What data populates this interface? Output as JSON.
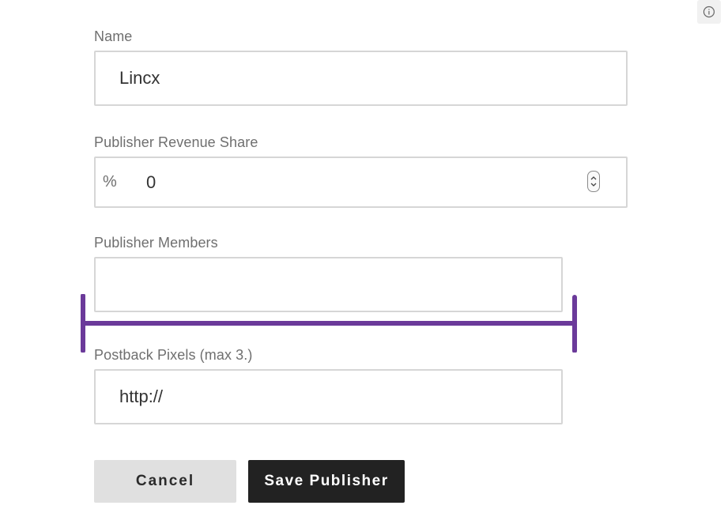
{
  "info_button": {
    "icon": "info-icon"
  },
  "form": {
    "name": {
      "label": "Name",
      "value": "Lincx"
    },
    "revenue_share": {
      "label": "Publisher Revenue Share",
      "prefix": "%",
      "value": "0"
    },
    "members": {
      "label": "Publisher Members",
      "value": ""
    },
    "postback": {
      "label": "Postback Pixels (max 3.)",
      "value": "http://"
    }
  },
  "actions": {
    "cancel_label": "Cancel",
    "save_label": "Save Publisher"
  },
  "colors": {
    "annotation_bracket": "#6b3a9a",
    "save_button_bg": "#222222",
    "cancel_button_bg": "#e0e0e0"
  }
}
